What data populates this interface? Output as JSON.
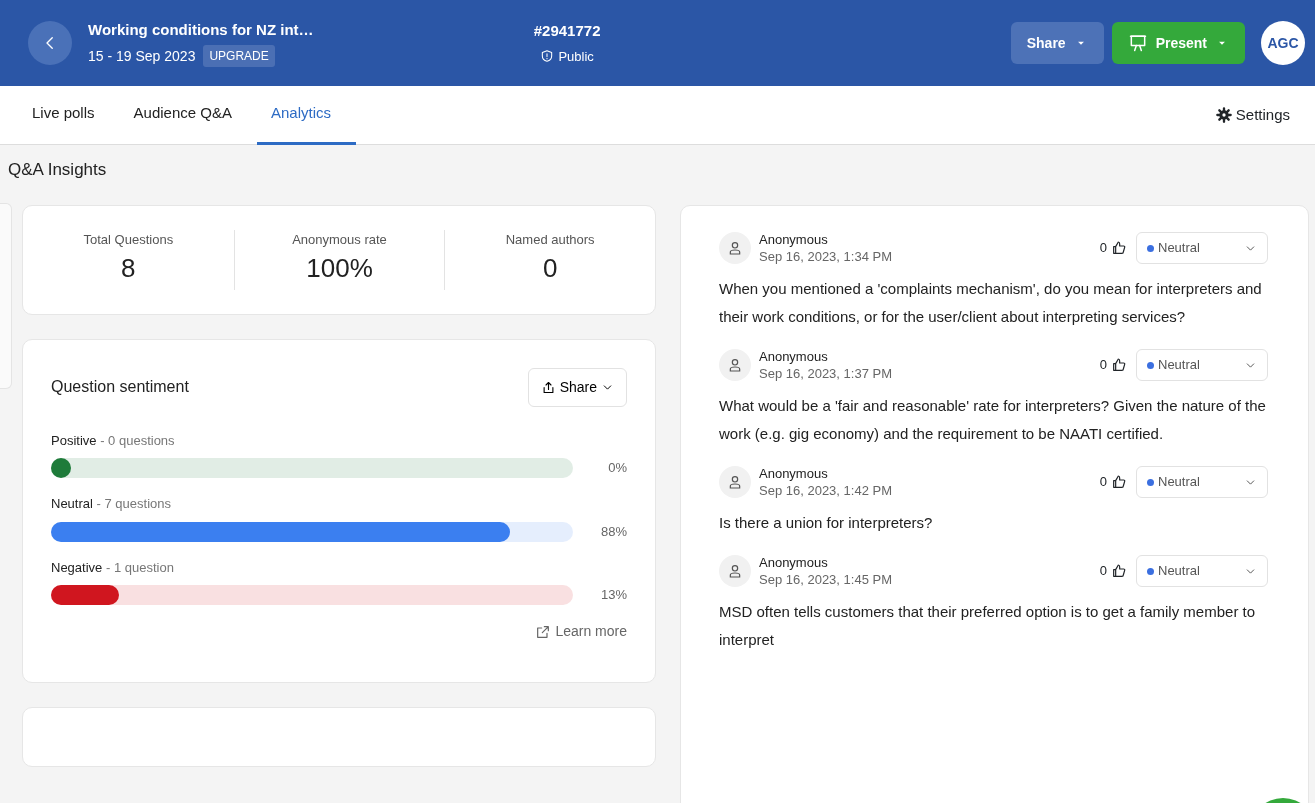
{
  "header": {
    "title": "Working conditions for NZ int…",
    "dates": "15 - 19 Sep 2023",
    "badge": "UPGRADE",
    "code": "#2941772",
    "visibility": "Public",
    "share_button": "Share",
    "present_button": "Present",
    "avatar": "AGC"
  },
  "tabs": [
    {
      "label": "Live polls",
      "selected": false
    },
    {
      "label": "Audience Q&A",
      "selected": false
    },
    {
      "label": "Analytics",
      "selected": true
    }
  ],
  "settings": "Settings",
  "page_title": "Q&A Insights",
  "stats": [
    {
      "label": "Total Questions",
      "value": "8"
    },
    {
      "label": "Anonymous rate",
      "value": "100%"
    },
    {
      "label": "Named authors",
      "value": "0"
    }
  ],
  "sentiment": {
    "title": "Question sentiment",
    "share_button": "Share",
    "learn_more": "Learn more",
    "rows": [
      {
        "name": "Positive",
        "count": "- 0 questions",
        "level": 0,
        "percent": "0%",
        "color": "#1e7b3a"
      },
      {
        "name": "Neutral",
        "count": "- 7 questions",
        "level": 0.88,
        "percent": "88%",
        "color": "#3b7ff0"
      },
      {
        "name": "Negative",
        "count": "- 1 question",
        "level": 0.13,
        "percent": "13%",
        "color": "#d0161f"
      }
    ]
  },
  "questions": [
    {
      "author": "Anonymous",
      "time": "Sep 16, 2023, 1:34 PM",
      "likes": "0",
      "sentiment": "Neutral",
      "color": "#3b6fe0",
      "text": "When you mentioned a 'complaints mechanism', do you mean for interpreters and their work conditions, or for the user/client about interpreting services?"
    },
    {
      "author": "Anonymous",
      "time": "Sep 16, 2023, 1:37 PM",
      "likes": "0",
      "sentiment": "Neutral",
      "color": "#3b6fe0",
      "text": "What would be a 'fair and reasonable' rate for interpreters? Given the nature of the work (e.g. gig economy) and the requirement to be NAATI certified."
    },
    {
      "author": "Anonymous",
      "time": "Sep 16, 2023, 1:42 PM",
      "likes": "0",
      "sentiment": "Neutral",
      "color": "#3b6fe0",
      "text": "Is there a union for interpreters?"
    },
    {
      "author": "Anonymous",
      "time": "Sep 16, 2023, 1:45 PM",
      "likes": "0",
      "sentiment": "Neutral",
      "color": "#3b6fe0",
      "text": "MSD often tells customers that their preferred option is to get a family member to interpret"
    }
  ]
}
